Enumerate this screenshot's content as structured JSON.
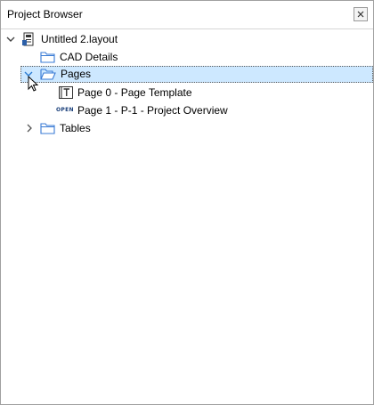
{
  "panel": {
    "title": "Project Browser"
  },
  "tree": {
    "root": {
      "label": "Untitled 2.layout",
      "icon": "layout-file-icon",
      "expanded": true
    },
    "items": [
      {
        "label": "CAD Details",
        "icon": "folder-icon"
      },
      {
        "label": "Pages",
        "icon": "folder-open-icon",
        "expanded": true,
        "selected": true
      },
      {
        "label": "Page 0 - Page Template",
        "icon": "template-page-icon"
      },
      {
        "label": "Page 1 - P-1 - Project Overview",
        "icon": "open-page-icon",
        "badge": "OPEN"
      },
      {
        "label": "Tables",
        "icon": "folder-icon",
        "expanded": false
      }
    ]
  },
  "colors": {
    "selection": "#cde8ff",
    "chevron_hover": "#2b7cd3",
    "folder": "#3a7bd5"
  }
}
